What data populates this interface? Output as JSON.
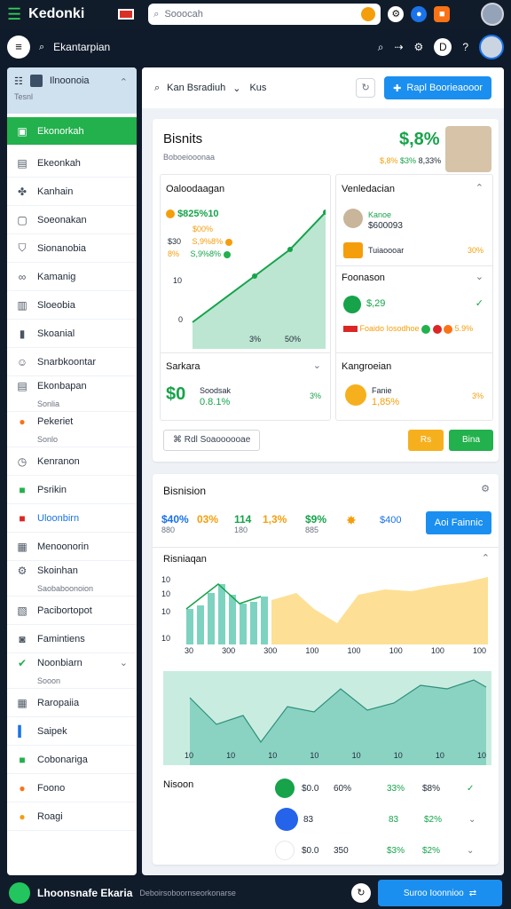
{
  "topbar": {
    "brand": "Kedonki",
    "search_placeholder": "Sooocah"
  },
  "secbar": {
    "title": "Ekantarpian",
    "pill": "D"
  },
  "sidebar": {
    "header_title": "Ilnoonoia",
    "header_sub": "Tesnl",
    "items": [
      {
        "label": "Ekonorkah"
      },
      {
        "label": "Ekeonkah"
      },
      {
        "label": "Kanhain"
      },
      {
        "label": "Soeonakan"
      },
      {
        "label": "Sionanobia"
      },
      {
        "label": "Kamanig"
      },
      {
        "label": "Sloeobia"
      },
      {
        "label": "Skoanial"
      },
      {
        "label": "Snarbkoontar"
      },
      {
        "label": "Ekonbapan",
        "sub": "Sonlia"
      },
      {
        "label": "Pekeriet",
        "sub": "Sonlo"
      },
      {
        "label": "Kenranon"
      },
      {
        "label": "Psrikin"
      },
      {
        "label": "Uloonbirn"
      },
      {
        "label": "Menoonorin"
      },
      {
        "label": "Skoinhan",
        "sub": "Saobaboonoion"
      },
      {
        "label": "Pacibortopot"
      },
      {
        "label": "Famintiens"
      },
      {
        "label": "Noonbiarn",
        "sub": "Sooon"
      },
      {
        "label": "Raropaiia"
      },
      {
        "label": "Saipek"
      },
      {
        "label": "Cobonariga"
      },
      {
        "label": "Foono"
      },
      {
        "label": "Roagi"
      }
    ]
  },
  "toolbar": {
    "select_label": "Kan Bsradiuh",
    "filter_label": "Kus",
    "cta_label": "Rapl Boorieaooor"
  },
  "overview": {
    "title": "Bisnits",
    "subtitle": "Boboeiooonaa",
    "value": "$,8%",
    "sub_values": [
      "$,8%",
      "$3%",
      "8,33%"
    ],
    "left_panel": {
      "title": "Oaloodaagan",
      "main_value": "$825%10",
      "sub_value": "$00%",
      "row1": [
        "$30",
        "S,9%8%"
      ],
      "row2": [
        "8%",
        "S,9%8%"
      ],
      "y_ticks": [
        "10",
        "0"
      ],
      "x_ticks": [
        "3%",
        "50%"
      ],
      "bottom_title": "Sarkara",
      "bottom_big": "$0",
      "bottom_label": "Soodsak",
      "bottom_value": "0.8.1%",
      "bottom_right": "3%"
    },
    "right_panel": {
      "title": "Venledacian",
      "row1_label": "Kanoe",
      "row1_value": "$600093",
      "row2_label": "Tuiaoooar",
      "row2_value": "30%",
      "sub_title": "Foonason",
      "sub_value": "$,29",
      "legend_label": "Foaido Iosodhoe",
      "legend_value": "5.9%",
      "bottom_title": "Kangroeian",
      "bottom_label": "Fanie",
      "bottom_value": "1,85%",
      "bottom_right": "3%"
    },
    "actions": {
      "outline_label": "Rdl Soaoooooae",
      "yellow_label": "Rs",
      "green_label": "Bina"
    }
  },
  "analytics": {
    "title": "Bisnision",
    "metrics": [
      {
        "value": "$40%",
        "sub": "880"
      },
      {
        "value": "03%",
        "sub": ""
      },
      {
        "value": "114",
        "sub": "180"
      },
      {
        "value": "1,3%",
        "sub": ""
      },
      {
        "value": "$9%",
        "sub": "885"
      },
      {
        "value": "$400",
        "sub": ""
      }
    ],
    "button_label": "Aoi Fainnic",
    "chart_title": "Risniaqan",
    "y_ticks": [
      "10",
      "10",
      "10",
      "10"
    ],
    "x_ticks_top": [
      "30",
      "300",
      "300",
      "100",
      "100",
      "100",
      "100",
      "100"
    ],
    "x_ticks_bot": [
      "10",
      "10",
      "10",
      "10",
      "10",
      "10",
      "10",
      "10"
    ],
    "rows": [
      {
        "a": "$0.0",
        "b": "60%",
        "c": "33%",
        "d": "$8%"
      },
      {
        "a": "83",
        "b": "",
        "c": "83",
        "d": "$2%"
      },
      {
        "a": "$0.0",
        "b": "350",
        "c": "$3%",
        "d": "$2%"
      }
    ],
    "footer_label": "Nisoon"
  },
  "bottombar": {
    "name": "Lhoonsnafe Ekaria",
    "meta": "Deboirsoboornseorkonarse",
    "button_label": "Suroo Ioonnioo"
  },
  "colors": {
    "accent_green": "#22b14c",
    "accent_blue": "#1a8ff0",
    "accent_orange": "#f59e0b",
    "nav_bg": "#111c2b"
  }
}
